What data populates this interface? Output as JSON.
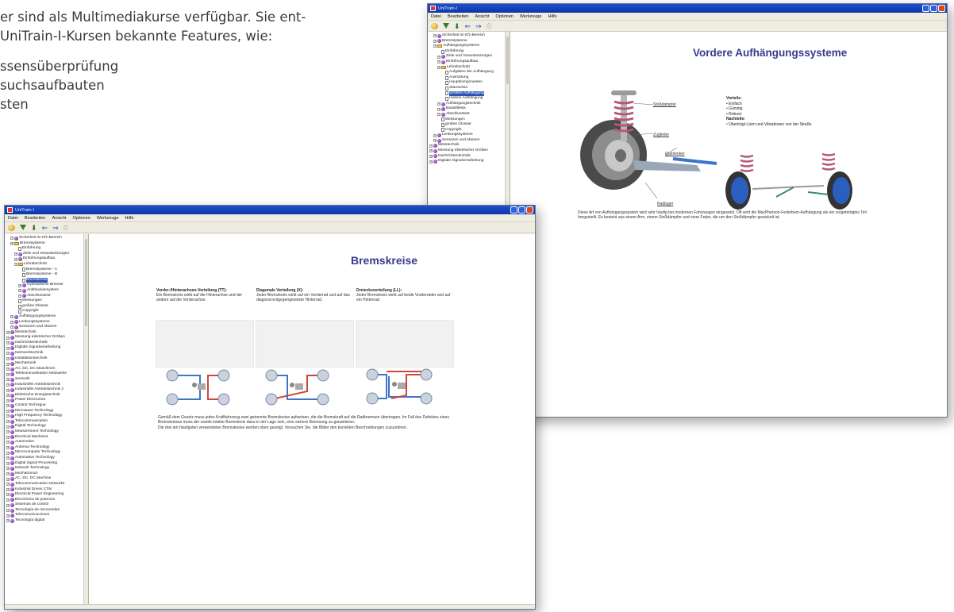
{
  "intro": {
    "line1": "er sind als Multimediakurse verfügbar. Sie ent-",
    "line2": "UniTrain-I-Kursen bekannte Features, wie:",
    "bullets": [
      "ssensüberprüfung",
      "suchsaufbauten",
      "sten"
    ]
  },
  "back_window": {
    "title": "UniTrain-I",
    "menu": [
      "Datei",
      "Bearbeiten",
      "Ansicht",
      "Optionen",
      "Werkzeuge",
      "Hilfe"
    ],
    "page_title": "Vordere Aufhängungssysteme",
    "labels": {
      "strut": "Stoßdämpfer",
      "spring": "Zugfeder",
      "arm": "Querlenker",
      "bottom": "Radlager"
    },
    "pros_heading": "Vorteile:",
    "pros": [
      "Einfach",
      "Günstig",
      "Robust"
    ],
    "cons_heading": "Nachteile:",
    "cons": [
      "Überträgt Lärm und Vibrationen von der Straße"
    ],
    "paragraph": "Diese Art von Aufhängungssystem wird sehr häufig bei modernen Fahrzeugen eingesetzt. Oft wird die MacPherson-Federbein-Aufhängung als ein vorgefertigtes Teil hergestellt. Es besteht aus einem Arm, einem Stoßdämpfer und einer Feder, die um den Stoßdämpfer gewickelt ist.",
    "tree": [
      {
        "t": "Sicherheit im Kfz-Bereich",
        "k": "gem",
        "d": 1
      },
      {
        "t": "Bremssysteme",
        "k": "gem",
        "d": 1
      },
      {
        "t": "Aufhängungssysteme",
        "k": "fold",
        "d": 1
      },
      {
        "t": "Einführung",
        "k": "doc",
        "d": 2
      },
      {
        "t": "Ziele und Voraussetzungen",
        "k": "gem",
        "d": 2
      },
      {
        "t": "Einführungsaufbau",
        "k": "gem",
        "d": 2
      },
      {
        "t": "Lehrabschnitt",
        "k": "fold",
        "d": 2
      },
      {
        "t": "Aufgaben der Aufhängung",
        "k": "doc",
        "d": 3
      },
      {
        "t": "Ausrüstung",
        "k": "doc",
        "d": 3
      },
      {
        "t": "Hauptkomponenten",
        "k": "doc",
        "d": 3
      },
      {
        "t": "Starrachse",
        "k": "doc",
        "d": 3
      },
      {
        "t": "Vordere Aufhängung",
        "k": "doc",
        "d": 3,
        "sel": true
      },
      {
        "t": "Hintere Aufhängung",
        "k": "doc",
        "d": 3
      },
      {
        "t": "Aufhängungstechnik",
        "k": "gem",
        "d": 2
      },
      {
        "t": "Bauteiltests",
        "k": "gem",
        "d": 2
      },
      {
        "t": "Abschlusstest",
        "k": "gem",
        "d": 2
      },
      {
        "t": "Messungen",
        "k": "doc",
        "d": 2
      },
      {
        "t": "großes Glossar",
        "k": "doc",
        "d": 2
      },
      {
        "t": "Copyright",
        "k": "doc",
        "d": 2
      },
      {
        "t": "Lenkungssysteme",
        "k": "gem",
        "d": 1
      },
      {
        "t": "Sensoren und Aktoren",
        "k": "gem",
        "d": 1
      },
      {
        "t": "Messtechnik",
        "k": "gem",
        "d": 0
      },
      {
        "t": "Messung elektrischer Größen",
        "k": "gem",
        "d": 0
      },
      {
        "t": "Nachrichtentechnik",
        "k": "gem",
        "d": 0
      },
      {
        "t": "Digitale Signalverarbeitung",
        "k": "gem",
        "d": 0
      }
    ]
  },
  "front_window": {
    "title": "UniTrain-I",
    "menu": [
      "Datei",
      "Bearbeiten",
      "Ansicht",
      "Optionen",
      "Werkzeuge",
      "Hilfe"
    ],
    "page_title": "Bremskreise",
    "columns": [
      {
        "heading": "Vorder-/Hinterachsen-Verteilung (TT):",
        "text": "Ein Bremskreis wirkt auf die Hinterachse und der andere auf die Vorderachse."
      },
      {
        "heading": "Diagonale Verteilung (X):",
        "text": "Jeder Bremskreis wirkt auf ein Vorderrad und auf das diagonal entgegengesetzte Hinterrad."
      },
      {
        "heading": "Dreiecksverteilung (LL):",
        "text": "Jeder Bremskreis wirkt auf beide Vorderräder und auf ein Hinterrad."
      }
    ],
    "paragraph": [
      "Gemäß dem Gesetz muss jedes Kraftfahrzeug zwei getrennte Bremskreise aufweisen, die die Bremskraft auf die Radbremsen übertragen. Im Fall des Defektes eines Bremskreises muss der zweite intakte Bremskreis dazu in der Lage sein, eine sichere Bremsung zu garantieren.",
      "Die drei am häufigsten verwendeten Bremskreise werden oben gezeigt. Versuchen Sie, die Bilder den korrekten Beschreibungen zuzuordnen."
    ],
    "tree": [
      {
        "t": "Sicherheit im Kfz-Bereich",
        "k": "gem",
        "d": 1
      },
      {
        "t": "Bremssysteme",
        "k": "fold",
        "d": 1
      },
      {
        "t": "Einführung",
        "k": "doc",
        "d": 2
      },
      {
        "t": "Ziele und Voraussetzungen",
        "k": "gem",
        "d": 2
      },
      {
        "t": "Einführungsaufbau",
        "k": "gem",
        "d": 2
      },
      {
        "t": "Lehrabschnitt",
        "k": "fold",
        "d": 2
      },
      {
        "t": "Bremssysteme - A",
        "k": "doc",
        "d": 3
      },
      {
        "t": "Bremssysteme - B",
        "k": "doc",
        "d": 3
      },
      {
        "t": "Bremskreise",
        "k": "doc",
        "d": 3,
        "sel": true
      },
      {
        "t": "Hydraulische Bremse",
        "k": "gem",
        "d": 3
      },
      {
        "t": "Antiblockiersystem",
        "k": "gem",
        "d": 3
      },
      {
        "t": "Abschlusstest",
        "k": "gem",
        "d": 3
      },
      {
        "t": "Messungen",
        "k": "doc",
        "d": 2
      },
      {
        "t": "großes Glossar",
        "k": "doc",
        "d": 2
      },
      {
        "t": "Copyright",
        "k": "doc",
        "d": 2
      },
      {
        "t": "Aufhängungssysteme",
        "k": "gem",
        "d": 1
      },
      {
        "t": "Lenkungssysteme",
        "k": "gem",
        "d": 1
      },
      {
        "t": "Sensoren und Aktoren",
        "k": "gem",
        "d": 1
      },
      {
        "t": "Messtechnik",
        "k": "gem",
        "d": 0
      },
      {
        "t": "Messung elektrischer Größen",
        "k": "gem",
        "d": 0
      },
      {
        "t": "Nachrichtentechnik",
        "k": "gem",
        "d": 0
      },
      {
        "t": "Digitale Signalverarbeitung",
        "k": "gem",
        "d": 0
      },
      {
        "t": "Netzwerktechnik",
        "k": "gem",
        "d": 0
      },
      {
        "t": "Installationstechnik",
        "k": "gem",
        "d": 0
      },
      {
        "t": "Mechatronik",
        "k": "gem",
        "d": 0
      },
      {
        "t": "AC, DC, DC Maschinen",
        "k": "gem",
        "d": 0
      },
      {
        "t": "Telekommunikation Netzwerke",
        "k": "gem",
        "d": 0
      },
      {
        "t": "Sensorik",
        "k": "gem",
        "d": 0
      },
      {
        "t": "Industrielle Antriebstechnik",
        "k": "gem",
        "d": 0
      },
      {
        "t": "Industrielle Antriebstechnik 2",
        "k": "gem",
        "d": 0
      },
      {
        "t": "Elektrische Energietechnik",
        "k": "gem",
        "d": 0
      },
      {
        "t": "Power Electronics",
        "k": "gem",
        "d": 0
      },
      {
        "t": "Control Technique",
        "k": "gem",
        "d": 0
      },
      {
        "t": "Microwave Technology",
        "k": "gem",
        "d": 0
      },
      {
        "t": "High Frequency Technology",
        "k": "gem",
        "d": 0
      },
      {
        "t": "Telecommunication",
        "k": "gem",
        "d": 0
      },
      {
        "t": "Digital Technology",
        "k": "gem",
        "d": 0
      },
      {
        "t": "Measurement Technology",
        "k": "gem",
        "d": 0
      },
      {
        "t": "Electrical Machines",
        "k": "gem",
        "d": 0
      },
      {
        "t": "Automotive",
        "k": "gem",
        "d": 0
      },
      {
        "t": "Antenna Technology",
        "k": "gem",
        "d": 0
      },
      {
        "t": "Microcomputer Technology",
        "k": "gem",
        "d": 0
      },
      {
        "t": "Automation Technology",
        "k": "gem",
        "d": 0
      },
      {
        "t": "Digital Signal Processing",
        "k": "gem",
        "d": 0
      },
      {
        "t": "Network Technology",
        "k": "gem",
        "d": 0
      },
      {
        "t": "Mechatronics",
        "k": "gem",
        "d": 0
      },
      {
        "t": "AC, DC, DC Machine",
        "k": "gem",
        "d": 0
      },
      {
        "t": "Telecommunication Networks",
        "k": "gem",
        "d": 0
      },
      {
        "t": "Industrial Drives CTM",
        "k": "gem",
        "d": 0
      },
      {
        "t": "Electrical Power Engineering",
        "k": "gem",
        "d": 0
      },
      {
        "t": "Electrónica de potencia",
        "k": "gem",
        "d": 0
      },
      {
        "t": "Sistemas de control",
        "k": "gem",
        "d": 0
      },
      {
        "t": "Tecnología de microondas",
        "k": "gem",
        "d": 0
      },
      {
        "t": "Telecomunicaciones",
        "k": "gem",
        "d": 0
      },
      {
        "t": "Tecnología digital",
        "k": "gem",
        "d": 0
      }
    ]
  },
  "colors": {
    "titlebar": "#1f4fc9",
    "page_title": "#3a3a8e",
    "circuit_red": "#d0463b",
    "circuit_blue": "#3f74c9",
    "tire": "#3a3a3a",
    "rim": "#2a5fc0",
    "spring": "#b5577a"
  }
}
